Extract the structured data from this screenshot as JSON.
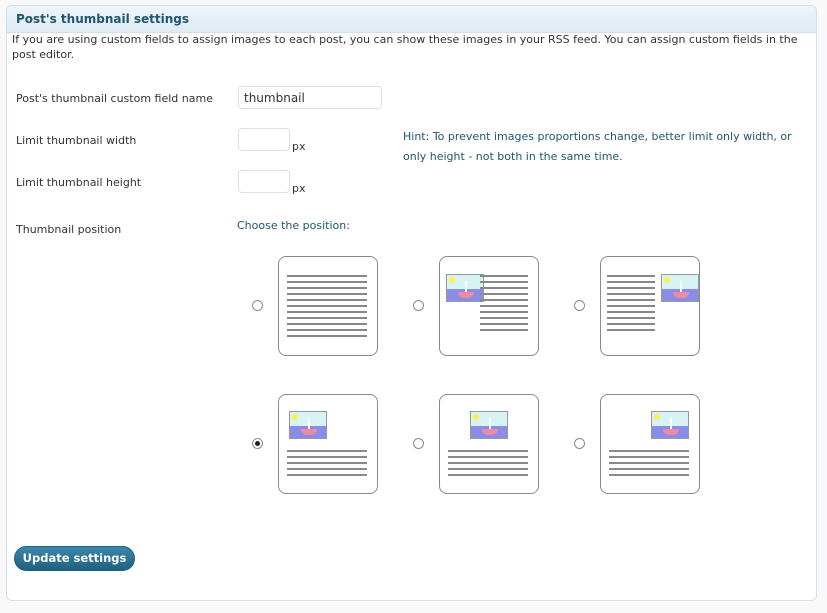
{
  "panel": {
    "title": "Post's thumbnail settings",
    "intro": "If you are using custom fields to assign images to each post, you can show these images in your RSS feed. You can assign custom fields in the post editor."
  },
  "fields": {
    "custom_field": {
      "label": "Post's thumbnail custom field name",
      "value": "thumbnail"
    },
    "width": {
      "label": "Limit thumbnail width",
      "value": "",
      "unit": "px"
    },
    "height": {
      "label": "Limit thumbnail height",
      "value": "",
      "unit": "px"
    },
    "hint": "Hint: To prevent images proportions change, better limit only width, or only height - not both in the same time."
  },
  "position": {
    "label": "Thumbnail position",
    "choose_label": "Choose the position:",
    "selected_index": 3,
    "options": [
      {
        "name": "none"
      },
      {
        "name": "top-left"
      },
      {
        "name": "top-right"
      },
      {
        "name": "above-left"
      },
      {
        "name": "above-center"
      },
      {
        "name": "above-right"
      }
    ]
  },
  "actions": {
    "update_label": "Update settings"
  },
  "colors": {
    "accent": "#21566e",
    "button": "#2a7397"
  }
}
